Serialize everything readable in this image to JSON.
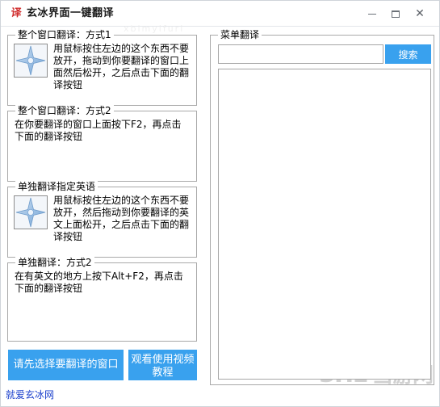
{
  "window": {
    "title": "玄冰界面一键翻译",
    "icon": "译",
    "controls": {
      "minimize": "minimize-icon",
      "maximize": "maximize-icon",
      "close": "✕"
    }
  },
  "watermarks": {
    "top": "xbimyifuri",
    "bottom_latin": "3HE",
    "bottom_cn": "当游网"
  },
  "left_panel": {
    "groups": [
      {
        "title": "整个窗口翻译：方式1",
        "has_drag_icon": true,
        "text": "用鼠标按住左边的这个东西不要放开，拖动到你要翻译的窗口上面然后松开，之后点击下面的翻译按钮"
      },
      {
        "title": "整个窗口翻译：方式2",
        "has_drag_icon": false,
        "text": "在你要翻译的窗口上面按下F2，再点击下面的翻译按钮"
      },
      {
        "title": "单独翻译指定英语",
        "has_drag_icon": true,
        "text": "用鼠标按住左边的这个东西不要放开，然后拖动到你要翻译的英文上面松开，之后点击下面的翻译按钮"
      },
      {
        "title": "单独翻译：方式2",
        "has_drag_icon": false,
        "text": "在有英文的地方上按下Alt+F2，再点击下面的翻译按钮"
      }
    ],
    "buttons": {
      "select_window": "请先选择要翻译的窗口",
      "video_tutorial_line1": "观看使用视频",
      "video_tutorial_line2": "教程"
    },
    "status_link": "就爱玄冰网"
  },
  "right_panel": {
    "group_title": "菜单翻译",
    "search": {
      "value": "",
      "placeholder": "",
      "button_label": "搜索"
    },
    "results": []
  },
  "colors": {
    "accent_blue": "#39a1ee",
    "link_blue": "#1a3fcc",
    "icon_red": "#d02b2b",
    "border_gray": "#a9a9a9"
  }
}
